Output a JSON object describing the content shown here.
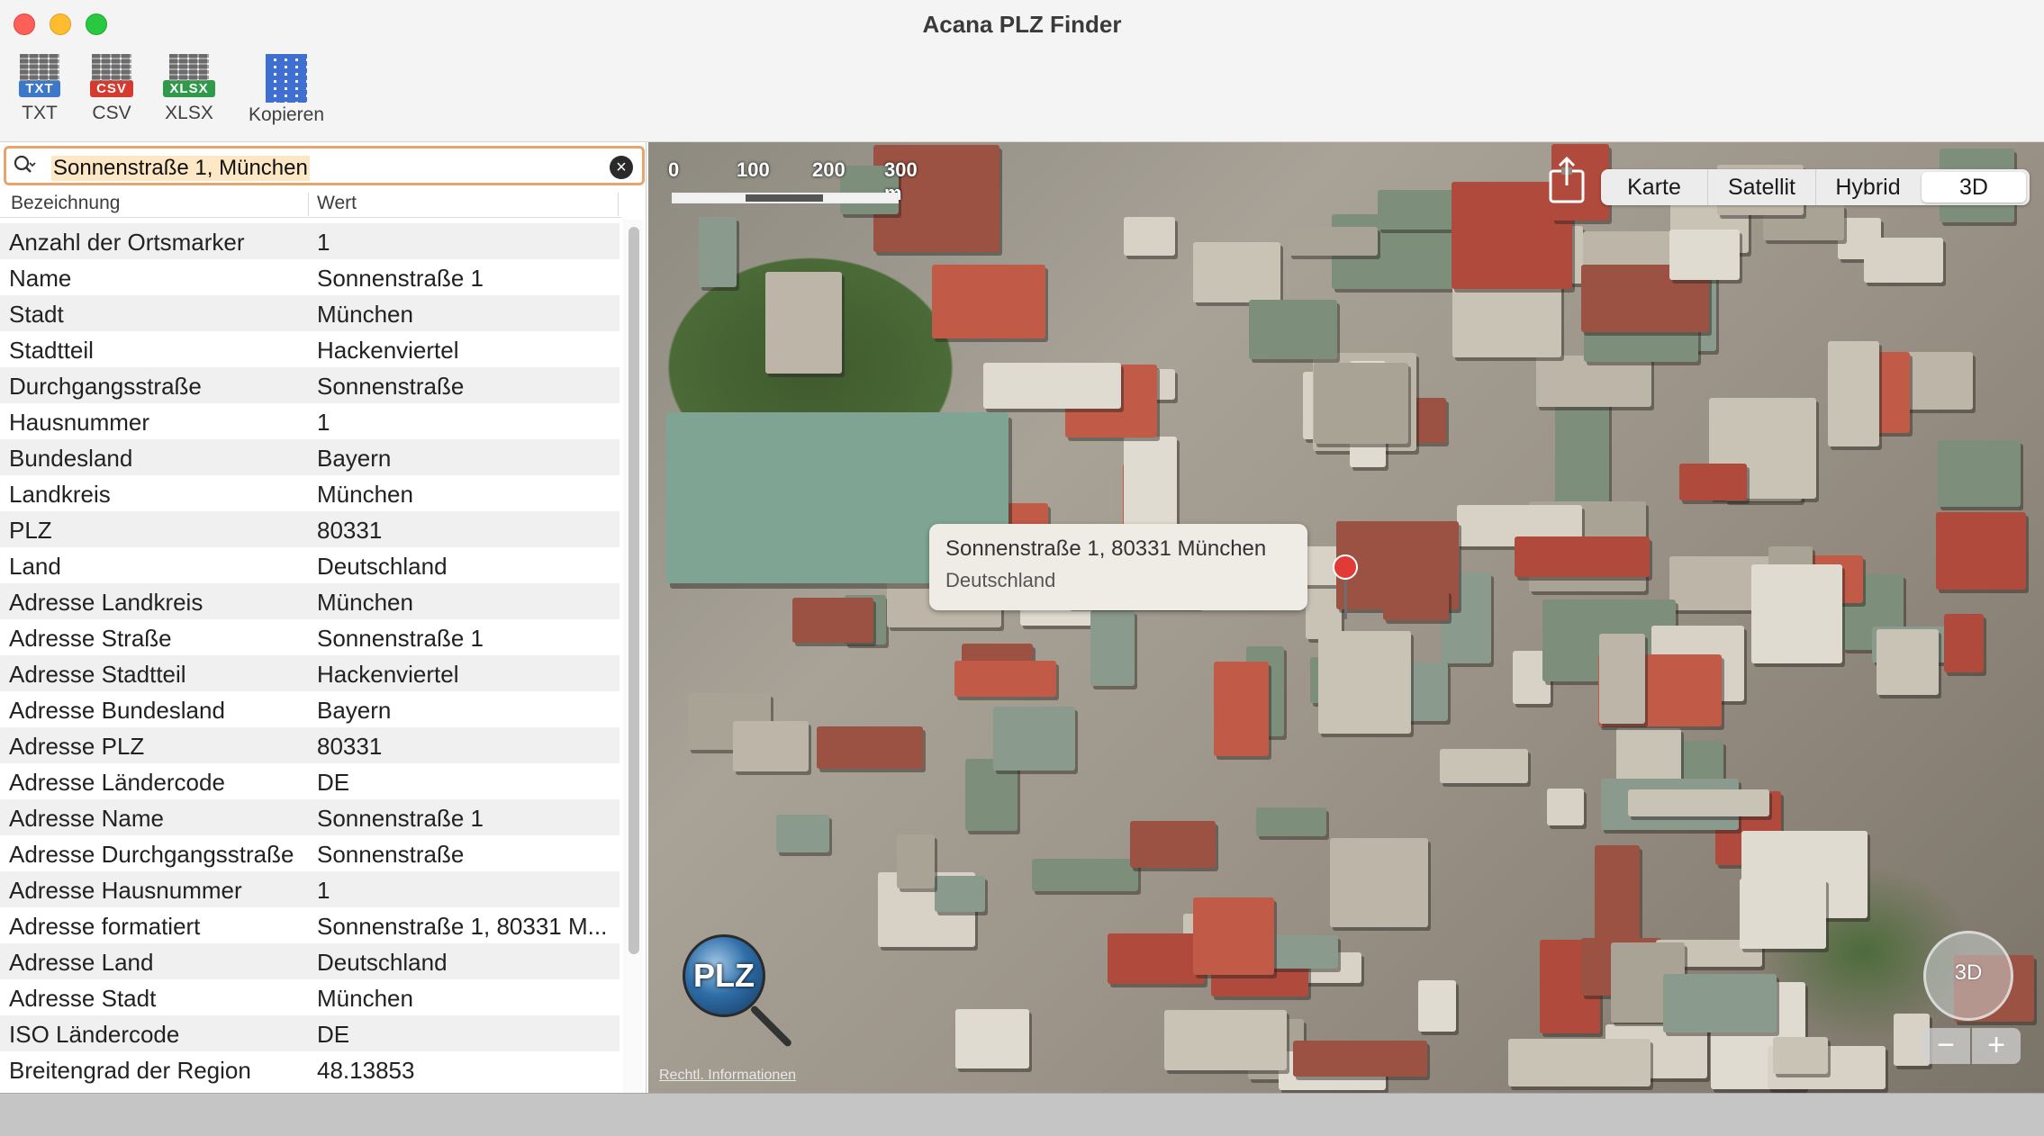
{
  "window": {
    "title": "Acana PLZ Finder"
  },
  "toolbar": {
    "txt": {
      "badge": "TXT",
      "label": "TXT",
      "color": "#3b78c9"
    },
    "csv": {
      "badge": "CSV",
      "label": "CSV",
      "color": "#d63a2f"
    },
    "xlsx": {
      "badge": "XLSX",
      "label": "XLSX",
      "color": "#2f9a4a"
    },
    "copy": {
      "label": "Kopieren"
    }
  },
  "search": {
    "value": "Sonnenstraße 1, München"
  },
  "table": {
    "headers": [
      "Bezeichnung",
      "Wert"
    ],
    "rows": [
      {
        "key": "Anzahl der Ortsmarker",
        "value": "1"
      },
      {
        "key": "Name",
        "value": "Sonnenstraße 1"
      },
      {
        "key": "Stadt",
        "value": "München"
      },
      {
        "key": "Stadtteil",
        "value": "Hackenviertel"
      },
      {
        "key": "Durchgangsstraße",
        "value": "Sonnenstraße"
      },
      {
        "key": "Hausnummer",
        "value": "1"
      },
      {
        "key": "Bundesland",
        "value": "Bayern"
      },
      {
        "key": "Landkreis",
        "value": "München"
      },
      {
        "key": "PLZ",
        "value": "80331"
      },
      {
        "key": "Land",
        "value": "Deutschland"
      },
      {
        "key": "Adresse Landkreis",
        "value": "München"
      },
      {
        "key": "Adresse Straße",
        "value": "Sonnenstraße 1"
      },
      {
        "key": "Adresse Stadtteil",
        "value": "Hackenviertel"
      },
      {
        "key": "Adresse Bundesland",
        "value": "Bayern"
      },
      {
        "key": "Adresse PLZ",
        "value": "80331"
      },
      {
        "key": "Adresse Ländercode",
        "value": "DE"
      },
      {
        "key": "Adresse Name",
        "value": "Sonnenstraße 1"
      },
      {
        "key": "Adresse Durchgangsstraße",
        "value": "Sonnenstraße"
      },
      {
        "key": "Adresse Hausnummer",
        "value": "1"
      },
      {
        "key": "Adresse formatiert",
        "value": "Sonnenstraße 1, 80331 M..."
      },
      {
        "key": "Adresse Land",
        "value": "Deutschland"
      },
      {
        "key": "Adresse Stadt",
        "value": "München"
      },
      {
        "key": "ISO Ländercode",
        "value": "DE"
      },
      {
        "key": "Breitengrad der Region",
        "value": "48.13853"
      }
    ]
  },
  "map": {
    "scale": {
      "labels": [
        "0",
        "100",
        "200",
        "300 m"
      ]
    },
    "types": [
      "Karte",
      "Satellit",
      "Hybrid",
      "3D"
    ],
    "selected_type": "3D",
    "callout": {
      "line1": "Sonnenstraße 1, 80331 München",
      "line2": "Deutschland"
    },
    "logo_text": "PLZ",
    "legal": "Rechtl. Informationen",
    "compass_label": "3D",
    "zoom_out": "−",
    "zoom_in": "+",
    "pin_color": "#e23a36"
  }
}
